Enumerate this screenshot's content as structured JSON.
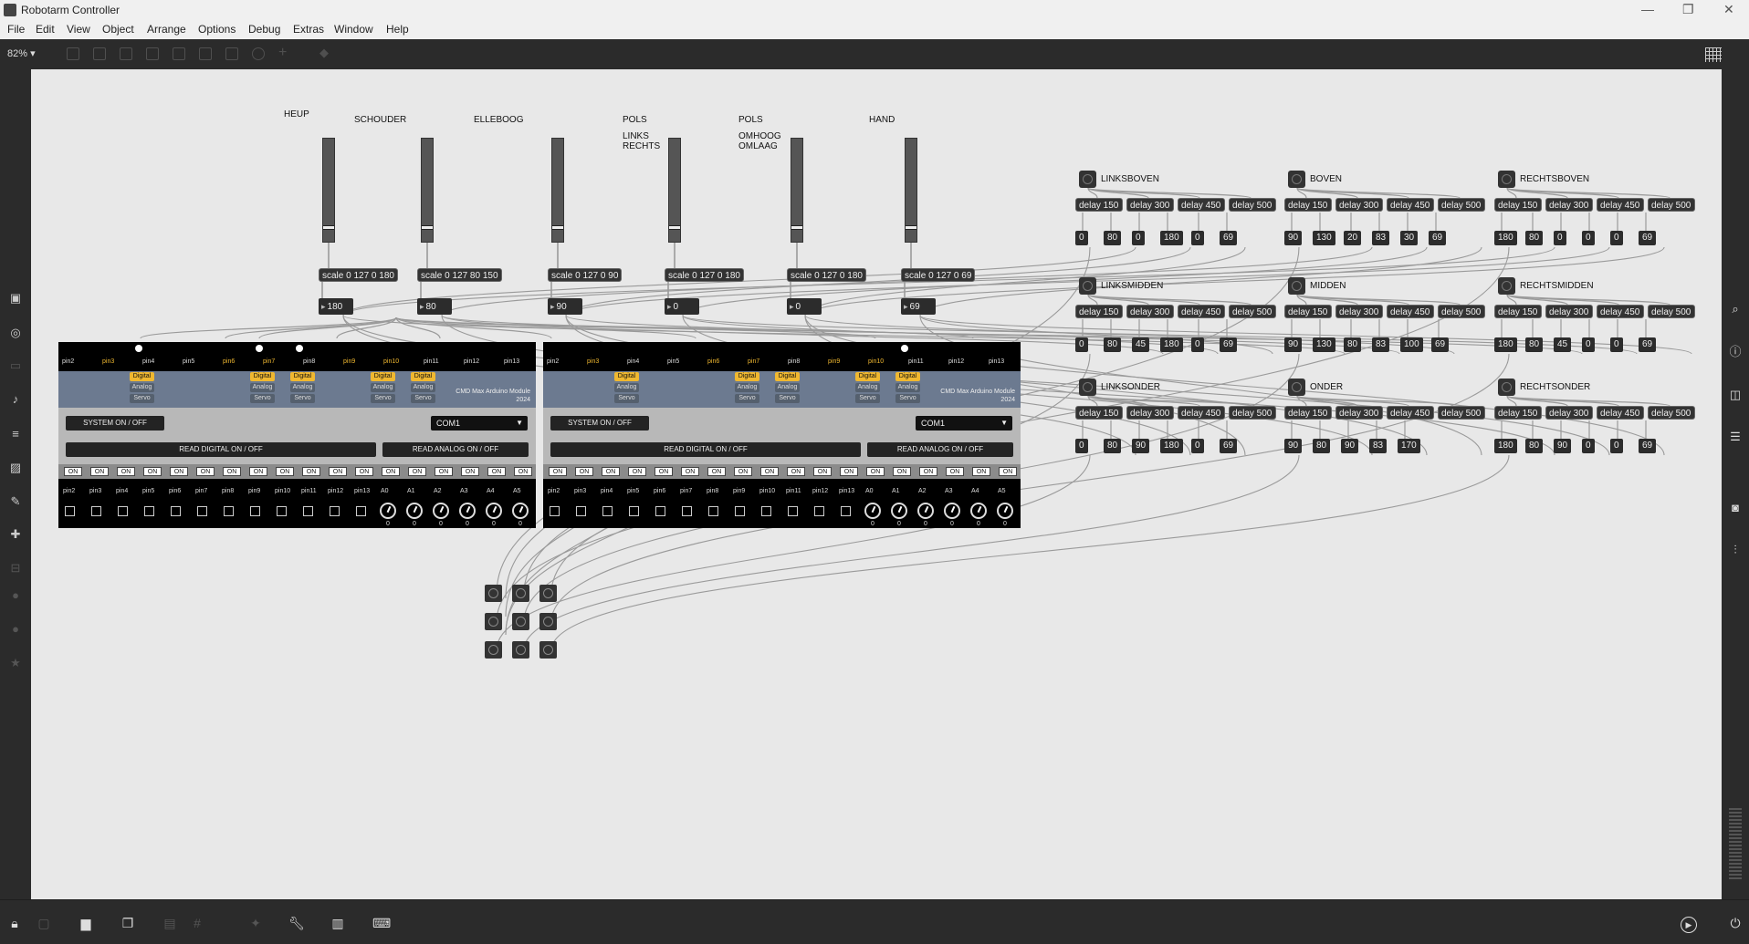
{
  "window": {
    "title": "Robotarm Controller"
  },
  "menu": [
    "File",
    "Edit",
    "View",
    "Object",
    "Arrange",
    "Options",
    "Debug",
    "Extras",
    "Window",
    "Help"
  ],
  "toolbar": {
    "zoom": "82%"
  },
  "joints": [
    {
      "label": "HEUP",
      "scale": "scale 0 127 0 180",
      "value": "180"
    },
    {
      "label": "SCHOUDER",
      "scale": "scale 0 127 80 150",
      "value": "80"
    },
    {
      "label": "ELLEBOOG",
      "scale": "scale 0 127 0 90",
      "value": "90"
    },
    {
      "label": "POLS",
      "sublabel": "LINKS\nRECHTS",
      "scale": "scale 0 127 0 180",
      "value": "0"
    },
    {
      "label": "POLS",
      "sublabel": "OMHOOG\nOMLAAG",
      "scale": "scale 0 127 0 180",
      "value": "0"
    },
    {
      "label": "HAND",
      "scale": "scale 0 127 0 69",
      "value": "69"
    }
  ],
  "presets": [
    {
      "name": "LINKSBOVEN",
      "values": [
        "0",
        "80",
        "0",
        "180",
        "0",
        "69"
      ]
    },
    {
      "name": "BOVEN",
      "values": [
        "90",
        "130",
        "20",
        "83",
        "30",
        "69"
      ]
    },
    {
      "name": "RECHTSBOVEN",
      "values": [
        "180",
        "80",
        "0",
        "0",
        "0",
        "69"
      ]
    },
    {
      "name": "LINKSMIDDEN",
      "values": [
        "0",
        "80",
        "45",
        "180",
        "0",
        "69"
      ]
    },
    {
      "name": "MIDDEN",
      "values": [
        "90",
        "130",
        "80",
        "83",
        "100",
        "69"
      ]
    },
    {
      "name": "RECHTSMIDDEN",
      "values": [
        "180",
        "80",
        "45",
        "0",
        "0",
        "69"
      ]
    },
    {
      "name": "LINKSONDER",
      "values": [
        "0",
        "80",
        "90",
        "180",
        "0",
        "69"
      ]
    },
    {
      "name": "ONDER",
      "values": [
        "90",
        "80",
        "90",
        "83",
        "170"
      ]
    },
    {
      "name": "RECHTSONDER",
      "values": [
        "180",
        "80",
        "90",
        "0",
        "0",
        "69"
      ]
    }
  ],
  "delays": [
    "delay 150",
    "delay 300",
    "delay 450",
    "delay 500"
  ],
  "module": {
    "title": "CMD Max Arduino Module",
    "year": "2024",
    "pins": [
      "pin2",
      "pin3",
      "pin4",
      "pin5",
      "pin6",
      "pin7",
      "pin8",
      "pin9",
      "pin10",
      "pin11",
      "pin12",
      "pin13"
    ],
    "tags": {
      "digital": "Digital",
      "analog": "Analog",
      "servo": "Servo"
    },
    "system_btn": "SYSTEM ON / OFF",
    "com_port": "COM1",
    "read_digital": "READ DIGITAL  ON / OFF",
    "read_analog": "READ ANALOG  ON / OFF",
    "on_label": "ON",
    "bottom_labels": [
      "pin2",
      "pin3",
      "pin4",
      "pin5",
      "pin6",
      "pin7",
      "pin8",
      "pin9",
      "pin10",
      "pin11",
      "pin12",
      "pin13",
      "A0",
      "A1",
      "A2",
      "A3",
      "A4",
      "A5"
    ],
    "dial_value": "0"
  }
}
